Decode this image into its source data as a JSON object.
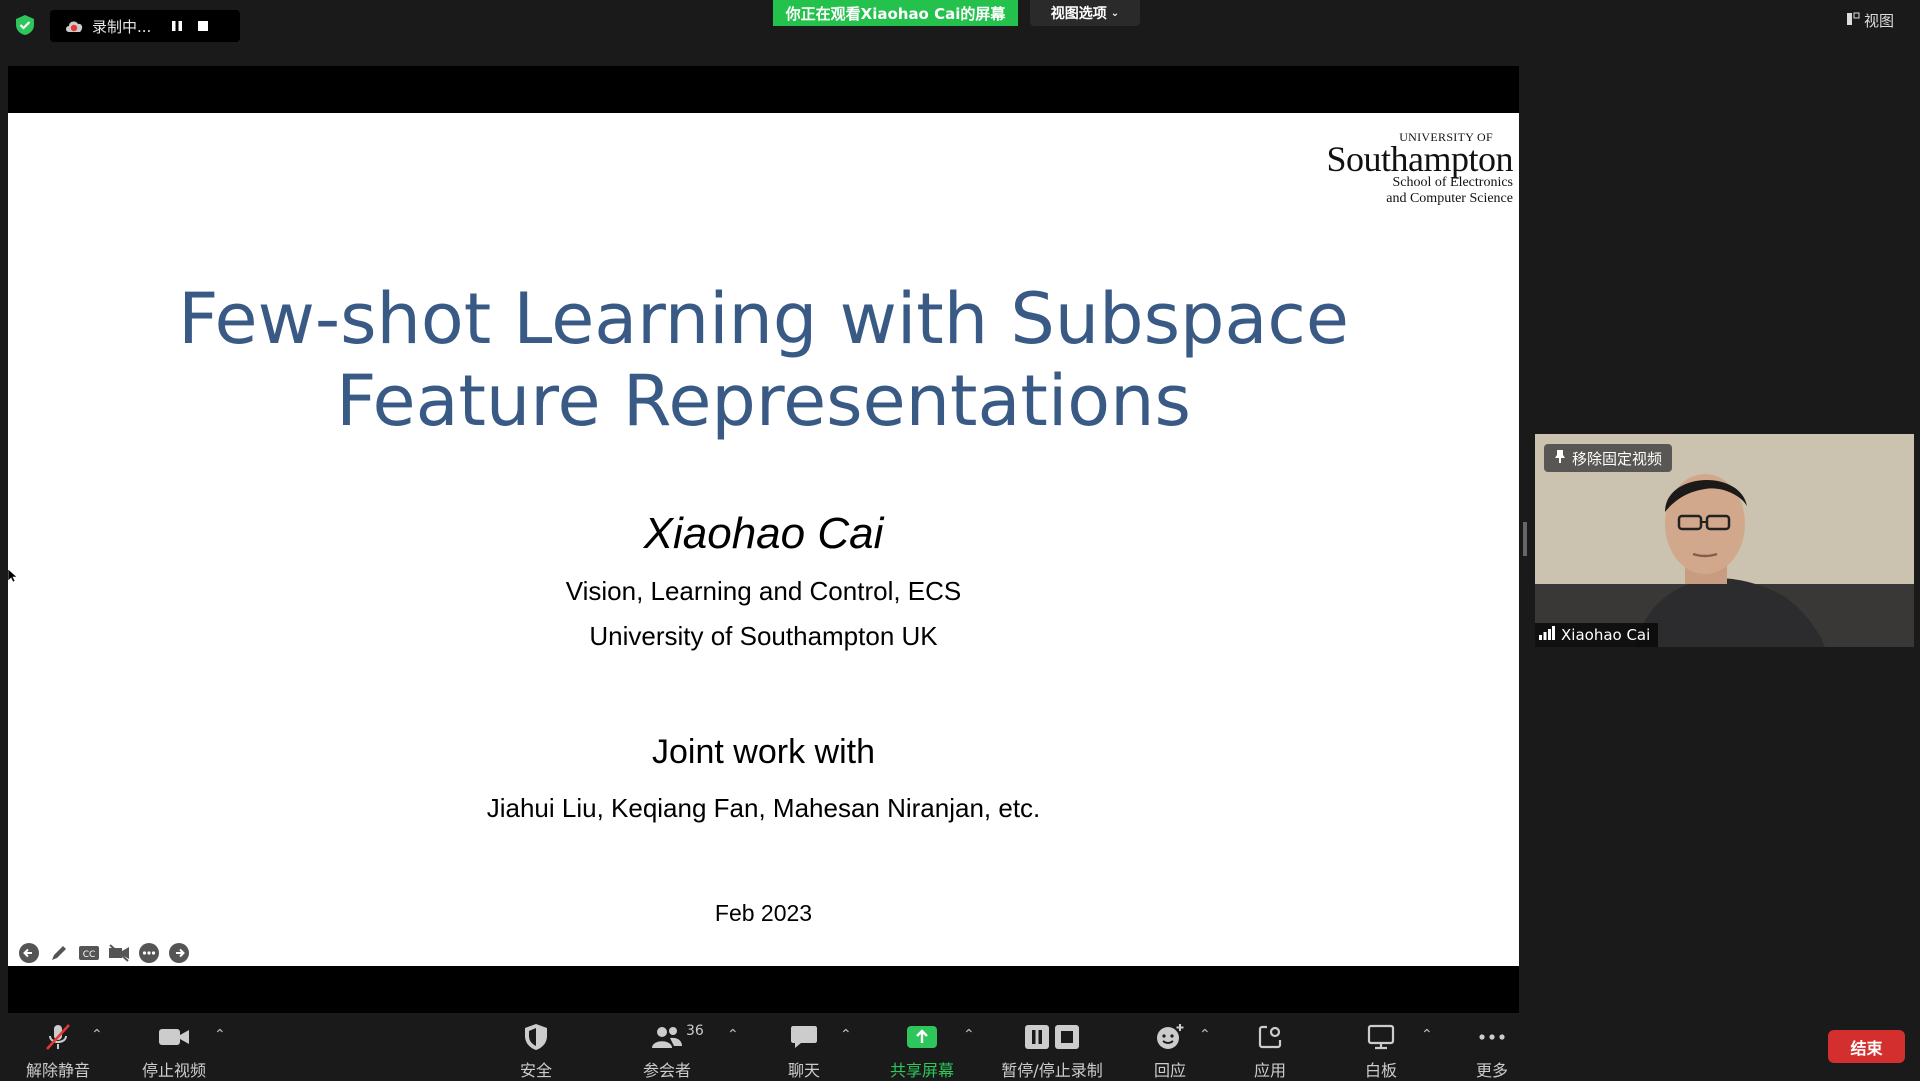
{
  "top_bar": {
    "recording_label": "录制中...",
    "viewing_banner": "你正在观看Xiaohao  Cai的屏幕",
    "view_options_label": "视图选项",
    "view_label": "视图"
  },
  "slide": {
    "logo": {
      "university_of": "UNIVERSITY OF",
      "name": "Southampton",
      "sub1": "School of Electronics",
      "sub2": "and Computer Science"
    },
    "title_line1": "Few-shot Learning with Subspace",
    "title_line2": "Feature Representations",
    "author": "Xiaohao Cai",
    "affiliation1": "Vision, Learning and Control, ECS",
    "affiliation2": "University of Southampton UK",
    "joint_heading": "Joint work with",
    "coauthors": "Jiahui Liu, Keqiang Fan, Mahesan Niranjan, etc.",
    "date": "Feb 2023"
  },
  "video": {
    "pin_label": "移除固定视频",
    "participant_name": "Xiaohao Cai"
  },
  "toolbar": {
    "unmute": "解除静音",
    "stop_video": "停止视频",
    "security": "安全",
    "participants": "参会者",
    "participants_count": "36",
    "chat": "聊天",
    "share_screen": "共享屏幕",
    "pause_stop_recording": "暂停/停止录制",
    "reactions": "回应",
    "apps": "应用",
    "whiteboard": "白板",
    "more": "更多",
    "end": "结束"
  },
  "colors": {
    "banner_green": "#24c24d",
    "title_blue": "#3a5a86",
    "end_red": "#d32f2f",
    "share_green": "#2ec55b"
  }
}
